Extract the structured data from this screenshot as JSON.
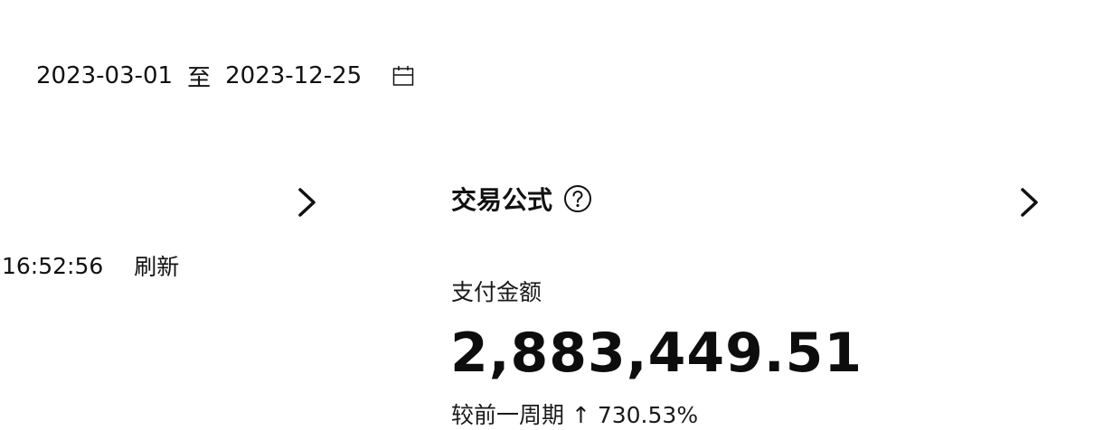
{
  "date_range": {
    "start": "2023-03-01",
    "separator": "至",
    "end": "2023-12-25"
  },
  "update": {
    "time": "16:52:56",
    "refresh_label": "刷新"
  },
  "section": {
    "title": "交易公式"
  },
  "metric": {
    "label": "支付金额",
    "value": "2,883,449.51",
    "compare_text": "较前一周期 ↑ 730.53%"
  },
  "icons": {
    "calendar": "calendar-icon",
    "chevron": "chevron-right-icon",
    "help": "question-circle-icon"
  }
}
